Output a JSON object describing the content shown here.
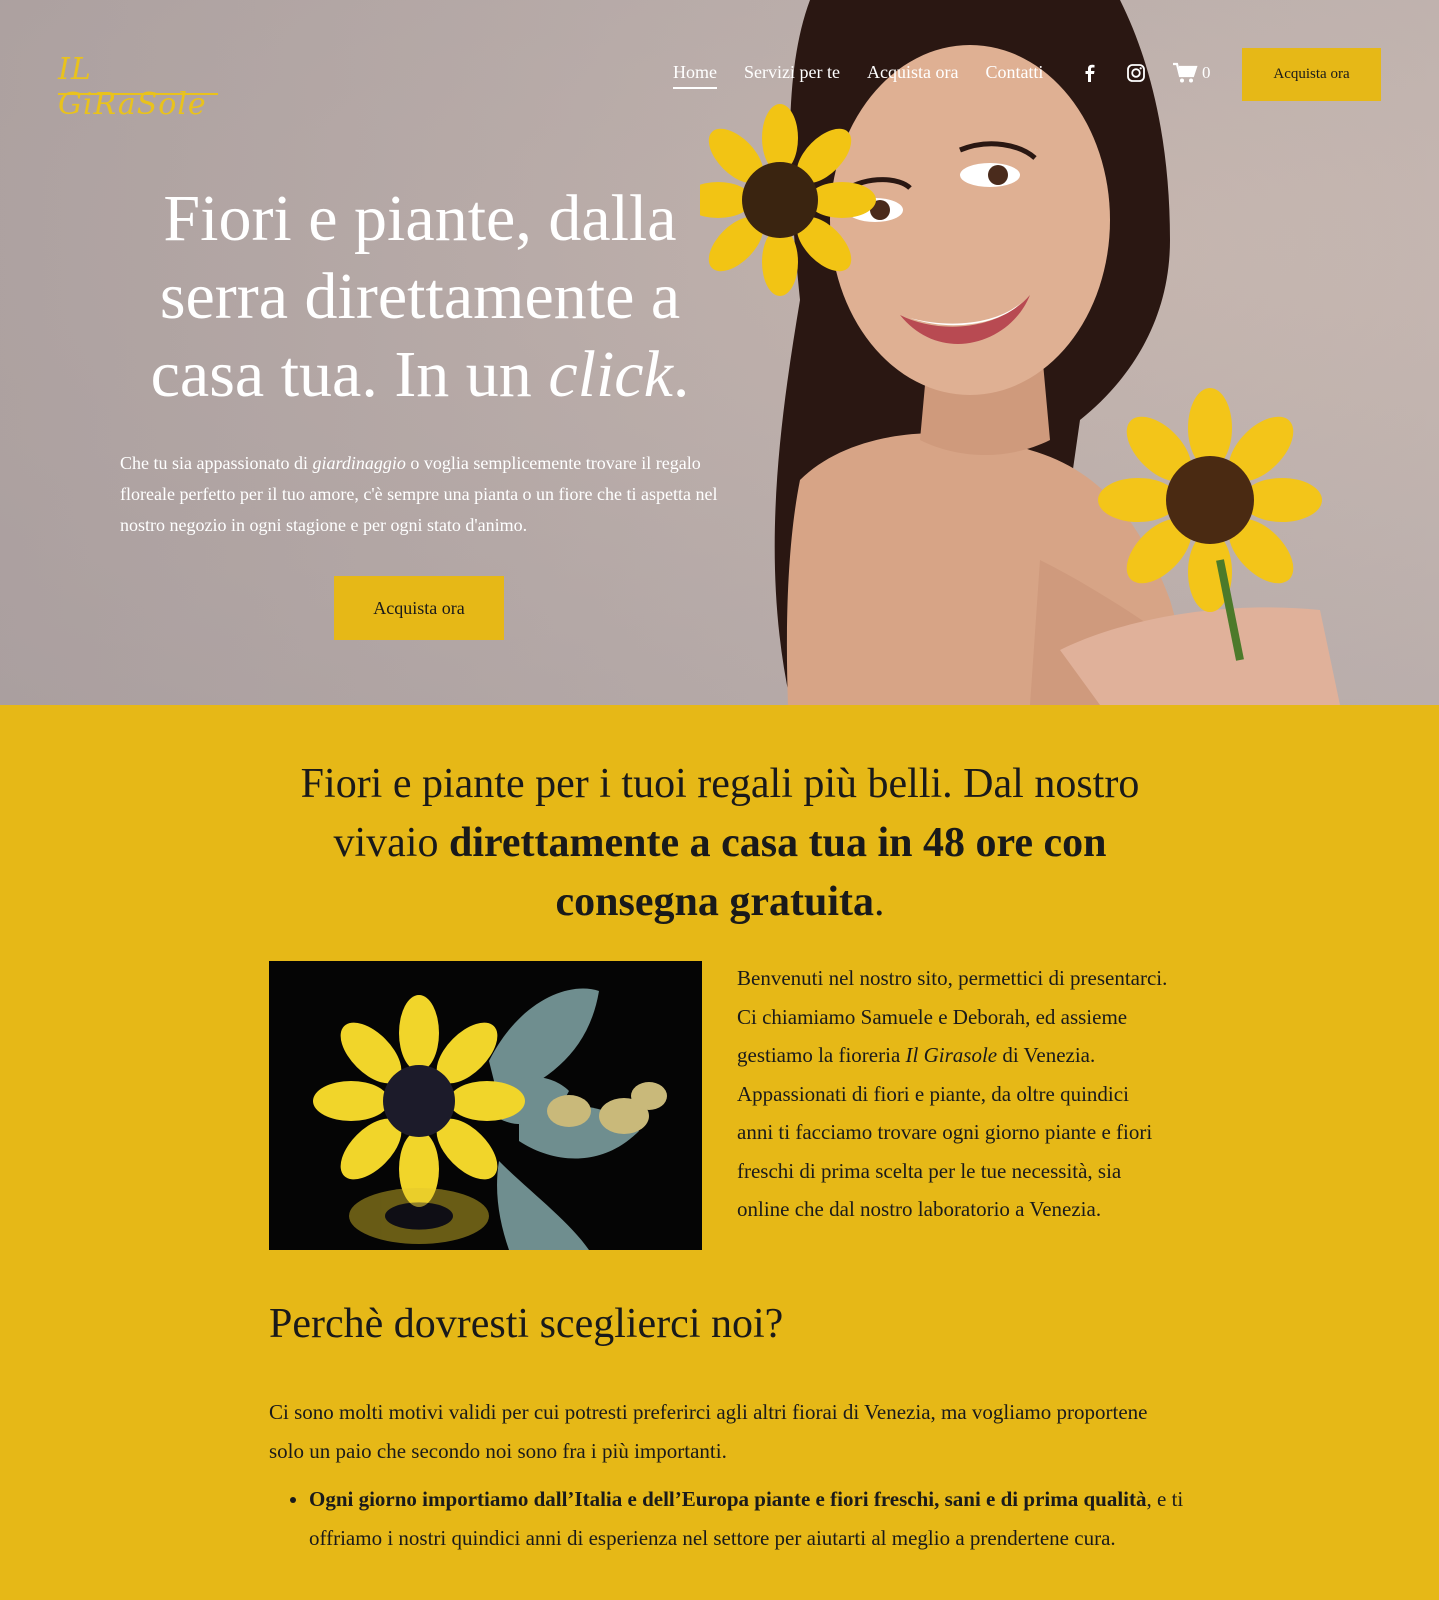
{
  "brand": {
    "logo_text": "IL GiRaSole"
  },
  "nav": {
    "items": [
      "Home",
      "Servizi per te",
      "Acquista ora",
      "Contatti"
    ],
    "cart_count": "0",
    "cta": "Acquista ora"
  },
  "hero": {
    "title_line1": "Fiori e piante, dalla",
    "title_line2": "serra direttamente a",
    "title_line3_prefix": "casa tua. In un ",
    "title_line3_em": "click",
    "title_line3_suffix": ".",
    "text_prefix": "Che tu sia appassionato di ",
    "text_em": "giardinaggio",
    "text_suffix": " o voglia semplicemente trovare il regalo floreale perfetto per il tuo amore, c'è sempre una pianta o un fiore che ti aspetta nel nostro negozio in ogni stagione e per ogni stato d'animo.",
    "button": "Acquista ora"
  },
  "main": {
    "lead_prefix": "Fiori e piante per i tuoi regali più belli. Dal nostro vivaio ",
    "lead_bold": "direttamente a casa tua in 48 ore con consegna gratuita",
    "lead_suffix": ".",
    "intro_prefix": "Benvenuti nel nostro sito, permettici di presentarci. Ci chiamiamo Samuele e Deborah, ed assieme gestiamo la fioreria ",
    "intro_em": "Il Girasole",
    "intro_suffix": " di Venezia. Appassionati di fiori e piante, da oltre quindici anni ti facciamo trovare ogni giorno piante e fiori freschi di prima scelta per le tue necessità, sia online che dal nostro laboratorio a Venezia.",
    "why_title": "Perchè dovresti sceglierci noi?",
    "why_text": "Ci sono molti motivi validi per cui potresti preferirci agli altri fiorai di Venezia, ma vogliamo proportene solo un paio che secondo noi sono fra i più importanti.",
    "bullet1_bold": "Ogni giorno importiamo dall’Italia e dell’Europa piante e fiori freschi, sani e di prima qualità",
    "bullet1_rest": ", e ti offriamo i nostri quindici anni di esperienza nel settore per aiutarti al meglio a prendertene cura."
  },
  "colors": {
    "accent": "#e6b817",
    "text": "#1a1a1a",
    "hero_bg": "#bfb2ae"
  },
  "icons": [
    "facebook-icon",
    "instagram-icon",
    "cart-icon"
  ]
}
